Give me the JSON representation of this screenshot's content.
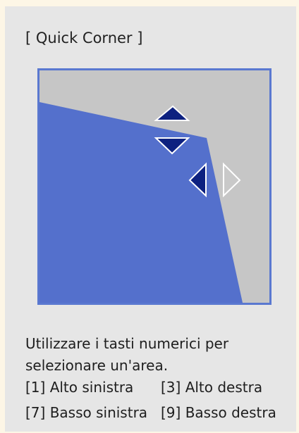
{
  "dialog": {
    "title": "[ Quick Corner ]"
  },
  "preview": {
    "frame_color": "#5a78d0",
    "background_color": "#c6c6c6",
    "image_color": "#5470cc",
    "selected_arrow_color": "#0d2180",
    "unselected_arrow_color": "#c9c9c9",
    "arrows": {
      "up": "arrow-up-icon",
      "down": "arrow-down-icon",
      "left": "arrow-left-icon",
      "right": "arrow-right-icon"
    }
  },
  "instructions": {
    "line1": "Utilizzare i tasti numerici per",
    "line2": "selezionare un'area.",
    "keys": [
      {
        "label": "[1] Alto sinistra"
      },
      {
        "label": "[3] Alto destra"
      },
      {
        "label": "[7] Basso sinistra"
      },
      {
        "label": "[9] Basso destra"
      }
    ]
  }
}
